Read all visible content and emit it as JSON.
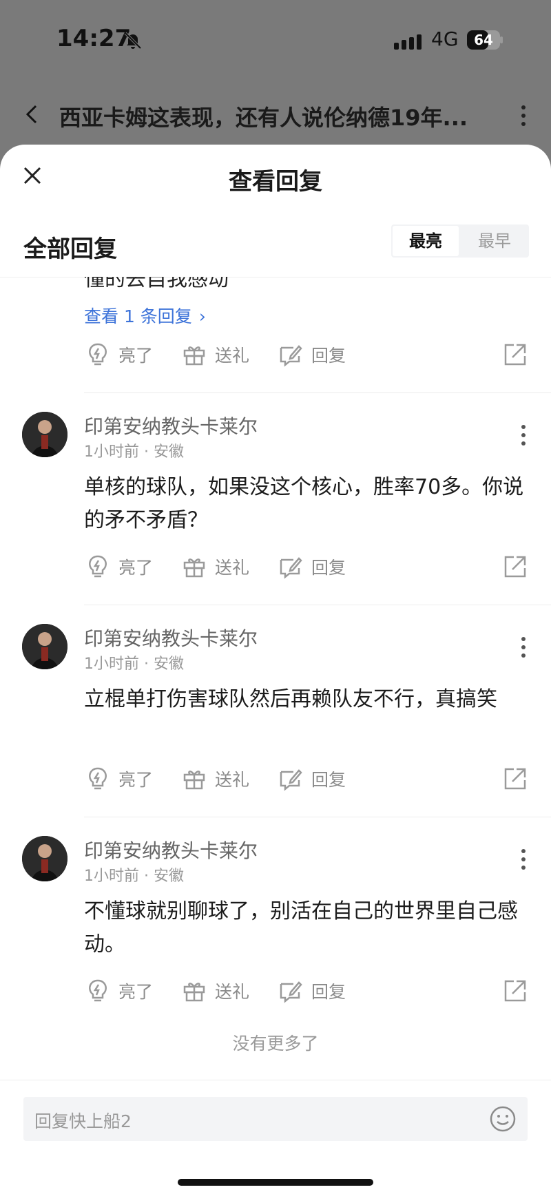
{
  "status_bar": {
    "time": "14:27",
    "network": "4G",
    "battery": "64",
    "battery_level": 0.64
  },
  "nav": {
    "title": "西亚卡姆这表现，还有人说伦纳德19年..."
  },
  "sheet": {
    "title": "查看回复",
    "section_label": "全部回复",
    "sort_options": [
      "最亮",
      "最早"
    ],
    "active_sort": "最亮"
  },
  "previous": {
    "tail_text": "懂的去自我感动",
    "view_more": "查看 1 条回复"
  },
  "actions": {
    "like": "亮了",
    "gift": "送礼",
    "reply": "回复"
  },
  "comments": [
    {
      "username": "印第安纳教头卡莱尔",
      "meta": "1小时前 · 安徽",
      "text": "单核的球队，如果没这个核心，胜率70多。你说的矛不矛盾？"
    },
    {
      "username": "印第安纳教头卡莱尔",
      "meta": "1小时前 · 安徽",
      "text": "立棍单打伤害球队然后再赖队友不行，真搞笑"
    },
    {
      "username": "印第安纳教头卡莱尔",
      "meta": "1小时前 · 安徽",
      "text": "不懂球就别聊球了，别活在自己的世界里自己感动。"
    }
  ],
  "footer": {
    "no_more": "没有更多了"
  },
  "input": {
    "placeholder": "回复快上船2"
  }
}
